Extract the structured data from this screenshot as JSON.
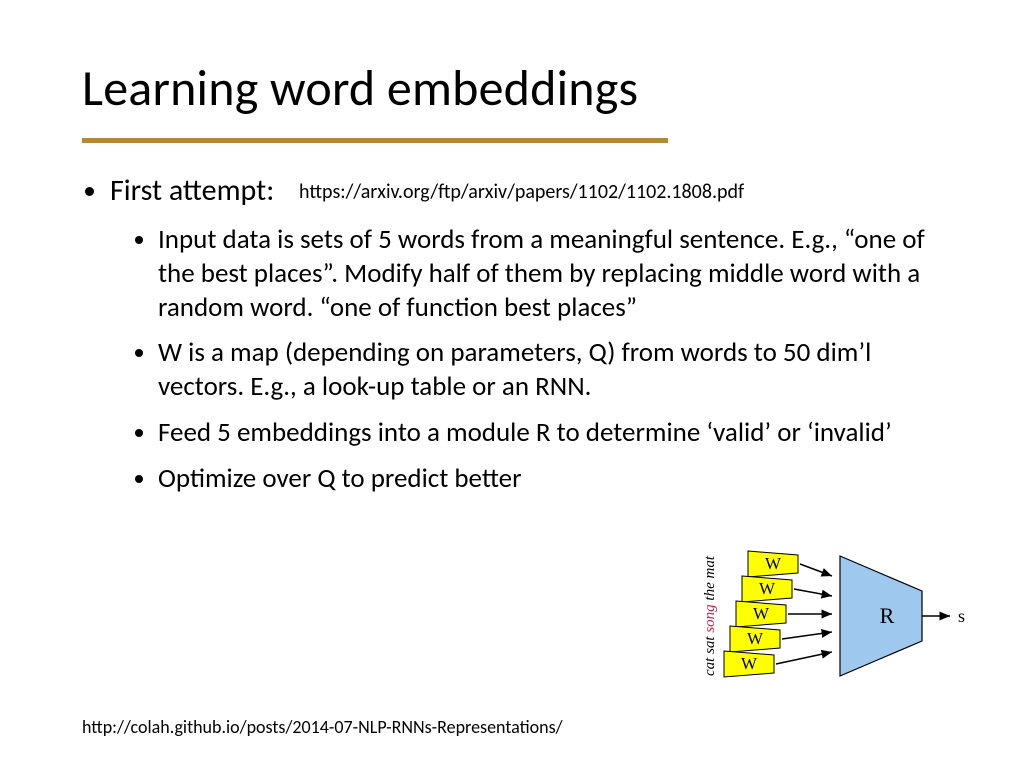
{
  "title": "Learning word embeddings",
  "first_attempt_label": "First attempt:",
  "arxiv_url": "https://arxiv.org/ftp/arxiv/papers/1102/1102.1808.pdf",
  "bullets": {
    "b1": "Input data is sets of 5 words from a meaningful sentence.  E.g., “one of the best places”.  Modify half of them by replacing middle word with a random word.  “one of function best places”",
    "b2": "W is a map (depending on parameters, Q) from words to 50 dim’l vectors.  E.g., a look-up table or an RNN.",
    "b3": "Feed 5 embeddings into a module R to determine ‘valid’ or ‘invalid’",
    "b4": "Optimize over Q to predict better"
  },
  "colah_url": "http://colah.github.io/posts/2014-07-NLP-RNNs-Representations/",
  "figure": {
    "W_label": "W",
    "R_label": "R",
    "s_label": "s",
    "words": {
      "w1": "cat",
      "w2": "sat",
      "w3": "song",
      "w4": "the",
      "w5": "mat"
    }
  }
}
